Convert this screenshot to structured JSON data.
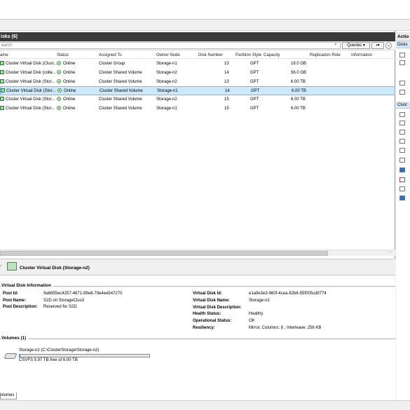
{
  "panel": {
    "header": "isks (6)",
    "search_placeholder": "earch",
    "queries_label": "Queries",
    "scroll_hint": "›"
  },
  "columns": [
    "ame",
    "Status",
    "Assigned To",
    "Owner Node",
    "Disk Number",
    "Partition Style",
    "Capacity",
    "Replication Role",
    "Information"
  ],
  "rows": [
    {
      "name": "Cluster Virtual Disk (Clust...",
      "status": "Online",
      "assigned": "Cluster Group",
      "owner": "Storage-n1",
      "number": "13",
      "style": "GPT",
      "capacity": "16.0 GB"
    },
    {
      "name": "Cluster Virtual Disk (colle...",
      "status": "Online",
      "assigned": "Cluster Shared Volume",
      "owner": "Storage-n2",
      "number": "14",
      "style": "GPT",
      "capacity": "56.0 GB"
    },
    {
      "name": "Cluster Virtual Disk (Stor...",
      "status": "Online",
      "assigned": "Cluster Shared Volume",
      "owner": "Storage-n2",
      "number": "13",
      "style": "GPT",
      "capacity": "6.00 TB"
    },
    {
      "name": "Cluster Virtual Disk (Stor...",
      "status": "Online",
      "assigned": "Cluster Shared Volume",
      "owner": "Storage-n1",
      "number": "14",
      "style": "GPT",
      "capacity": "6.00 TB"
    },
    {
      "name": "Cluster Virtual Disk (Stor...",
      "status": "Online",
      "assigned": "Cluster Shared Volume",
      "owner": "Storage-n2",
      "number": "15",
      "style": "GPT",
      "capacity": "6.00 TB"
    },
    {
      "name": "Cluster Virtual Disk (Stor...",
      "status": "Online",
      "assigned": "Cluster Shared Volume",
      "owner": "Storage-n1",
      "number": "15",
      "style": "GPT",
      "capacity": "6.00 TB"
    }
  ],
  "selected_row": 3,
  "detail": {
    "title": "Cluster Virtual Disk (Storage-n2)",
    "section": "Virtual Disk Information",
    "left": [
      {
        "label": "Pool Id:",
        "value": "9a6855ec4257-4671-99e8-79e4ee547270"
      },
      {
        "label": "Pool Name:",
        "value": "S2D on StorageClus3"
      },
      {
        "label": "Pool Description:",
        "value": "Reserved for S2D"
      }
    ],
    "right": [
      {
        "label": "Virtual Disk Id:",
        "value": "e1a9e3e3-960f-4cea-82b6-55f005cd9774"
      },
      {
        "label": "Virtual Disk Name:",
        "value": "Storage-n2"
      },
      {
        "label": "Virtual Disk Description:",
        "value": ""
      },
      {
        "label": "Health Status:",
        "value": "Healthy"
      },
      {
        "label": "Operational Status:",
        "value": "OK"
      },
      {
        "label": "Resiliency:",
        "value": "Mirror, Columns: 8 , Interleave: 256 KB"
      }
    ],
    "volumes_header": "Volumes (1)",
    "volume_name": "Storage-n2 (C:\\ClusterStorage\\Storage-n2)",
    "volume_info": "CSVFS 5.97 TB free of 6.00 TB",
    "volume_free_fraction": 0.995
  },
  "bottom_tab": "olumes",
  "actions": {
    "header": "Actio",
    "sub1": "Disks",
    "sub2": "Clust"
  }
}
